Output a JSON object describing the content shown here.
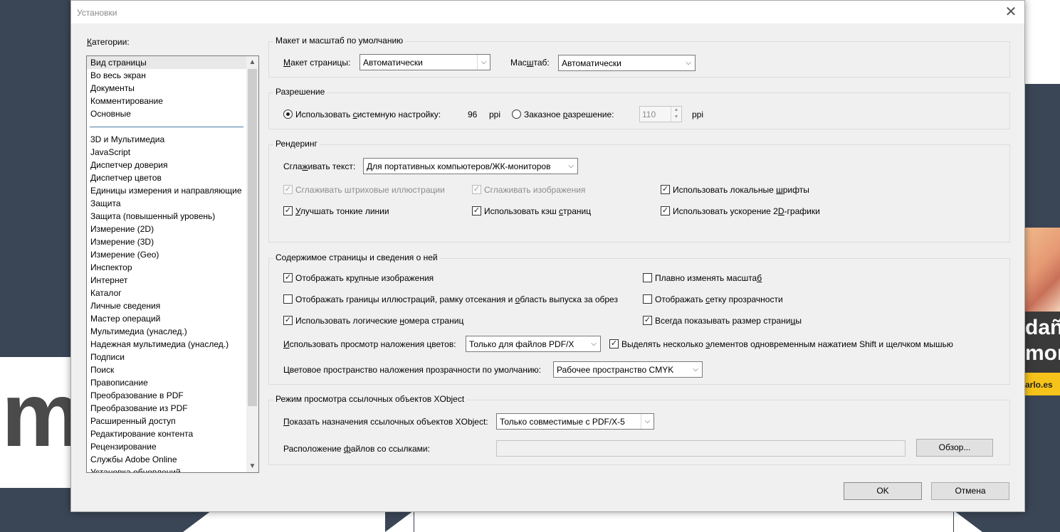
{
  "dialog": {
    "title": "Установки",
    "close_glyph": "✕"
  },
  "categories": {
    "label": "Категории:",
    "group1": [
      "Вид страницы",
      "Во весь экран",
      "Документы",
      "Комментирование",
      "Основные"
    ],
    "group2": [
      "3D и Мультимедиа",
      "JavaScript",
      "Диспетчер доверия",
      "Диспетчер цветов",
      "Единицы измерения и направляющие",
      "Защита",
      "Защита (повышенный уровень)",
      "Измерение (2D)",
      "Измерение (3D)",
      "Измерение (Geo)",
      "Инспектор",
      "Интернет",
      "Каталог",
      "Личные сведения",
      "Мастер операций",
      "Мультимедиа (унаслед.)",
      "Надежная мультимедиа (унаслед.)",
      "Подписи",
      "Поиск",
      "Правописание",
      "Преобразование в PDF",
      "Преобразование из PDF",
      "Расширенный доступ",
      "Редактирование контента",
      "Рецензирование",
      "Службы Adobe Online",
      "Установка обновлений"
    ],
    "selected": "Вид страницы"
  },
  "layout_group": {
    "title": "Макет и масштаб по умолчанию",
    "page_layout_label": "Макет страницы:",
    "page_layout_value": "Автоматически",
    "zoom_label": "Масштаб:",
    "zoom_value": "Автоматически"
  },
  "resolution_group": {
    "title": "Разрешение",
    "system_label": "Использовать системную настройку:",
    "system_value": "96",
    "system_unit": "ppi",
    "custom_label": "Заказное разрешение:",
    "custom_value": "110",
    "custom_unit": "ppi"
  },
  "rendering_group": {
    "title": "Рендеринг",
    "smooth_text_label": "Сглаживать текст:",
    "smooth_text_value": "Для портативных компьютеров/ЖК-мониторов",
    "smooth_line_art": "Сглаживать штриховые иллюстрации",
    "smooth_images": "Сглаживать изображения",
    "local_fonts": "Использовать локальные шрифты",
    "enhance_thin_lines": "Улучшать тонкие линии",
    "page_cache": "Использовать кэш страниц",
    "accel_2d": "Использовать ускорение 2D-графики"
  },
  "content_group": {
    "title": "Содержимое страницы и сведения о ней",
    "large_images": "Отображать крупные изображения",
    "smooth_zoom": "Плавно изменять масштаб",
    "art_trim_bleed": "Отображать границы иллюстраций, рамку отсекания и область выпуска за обрез",
    "transparency_grid": "Отображать сетку прозрачности",
    "logical_page_numbers": "Использовать логические номера страниц",
    "always_page_size": "Всегда показывать размер страницы",
    "overprint_label": "Использовать просмотр наложения цветов:",
    "overprint_value": "Только для файлов PDF/X",
    "shift_click": "Выделять несколько элементов одновременным нажатием Shift и щелчком мышью",
    "blend_space_label": "Цветовое пространство наложения прозрачности по умолчанию:",
    "blend_space_value": "Рабочее пространство CMYK"
  },
  "xobject_group": {
    "title": "Режим просмотра ссылочных объектов XObject",
    "show_targets_label": "Показать назначения ссылочных объектов XObject:",
    "show_targets_value": "Только совместимые с PDF/X-5",
    "location_label": "Расположение файлов со ссылками:",
    "location_value": "",
    "browse": "Обзор..."
  },
  "footer": {
    "ok": "OK",
    "cancel": "Отмена"
  },
  "background": {
    "letter": "m",
    "ad_line1": "daña",
    "ad_line2": "mono",
    "ad_link": "arlo.es"
  }
}
